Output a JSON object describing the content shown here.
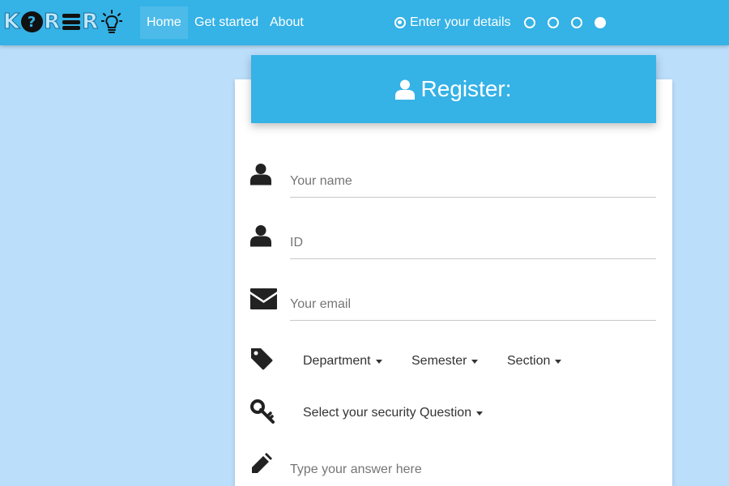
{
  "brand": {
    "letters_1": "K",
    "question_mark": "?",
    "letters_2": "R",
    "letters_3": "R"
  },
  "nav": {
    "home": "Home",
    "get_started": "Get started",
    "about": "About"
  },
  "steps": {
    "current_label": "Enter your details",
    "total": 4,
    "current_index": 1,
    "completed_index": 4
  },
  "form": {
    "title": "Register:",
    "name_placeholder": "Your name",
    "id_placeholder": "ID",
    "email_placeholder": "Your email",
    "department": "Department",
    "semester": "Semester",
    "section": "Section",
    "security_question": "Select your security Question",
    "answer_placeholder": "Type your answer here"
  },
  "colors": {
    "navbar": "#35b2e6",
    "page_background": "#bbdefb",
    "card": "#ffffff",
    "icon": "#222222"
  },
  "icons": [
    "user-icon",
    "envelope-icon",
    "tag-icon",
    "key-icon",
    "pencil-icon",
    "lightbulb-icon"
  ]
}
